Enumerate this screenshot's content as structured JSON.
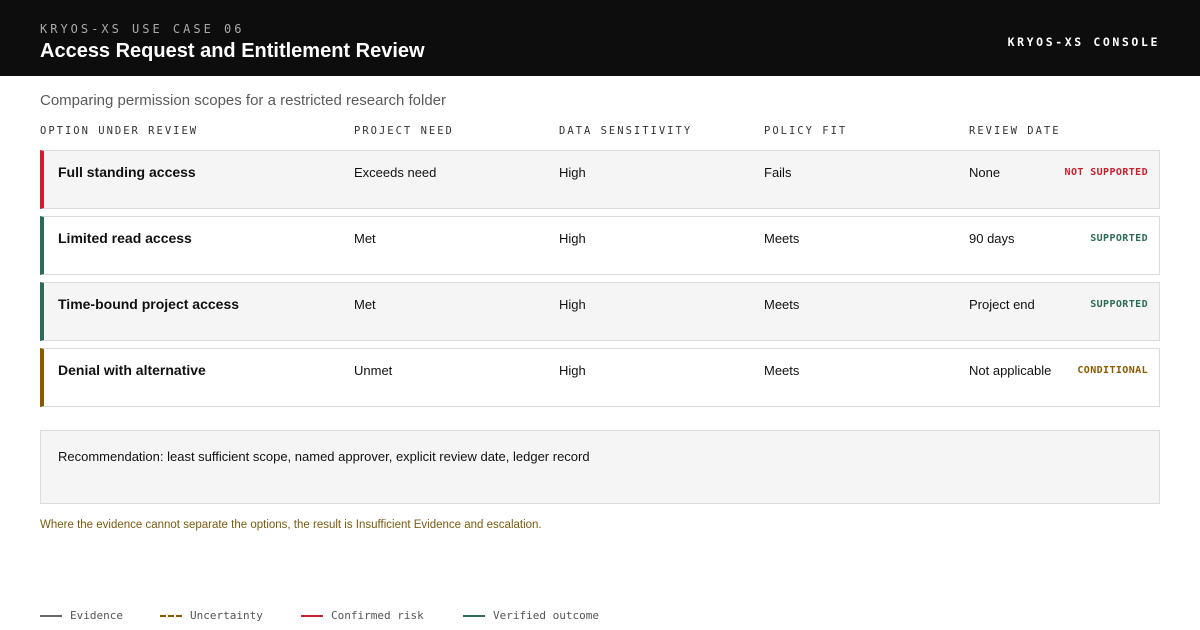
{
  "header": {
    "eyebrow": "KRYOS-XS USE CASE 06",
    "title": "Access Request and Entitlement Review",
    "console_label": "KRYOS-XS CONSOLE"
  },
  "subtitle": "Comparing permission scopes for a restricted research folder",
  "columns": [
    "OPTION UNDER REVIEW",
    "PROJECT NEED",
    "DATA SENSITIVITY",
    "POLICY FIT",
    "REVIEW DATE"
  ],
  "rows": [
    {
      "name": "Full standing access",
      "need": "Exceeds need",
      "sensitivity": "High",
      "policy": "Fails",
      "review": "None",
      "status": "NOT SUPPORTED"
    },
    {
      "name": "Limited read access",
      "need": "Met",
      "sensitivity": "High",
      "policy": "Meets",
      "review": "90 days",
      "status": "SUPPORTED"
    },
    {
      "name": "Time-bound project access",
      "need": "Met",
      "sensitivity": "High",
      "policy": "Meets",
      "review": "Project end",
      "status": "SUPPORTED"
    },
    {
      "name": "Denial with alternative",
      "need": "Unmet",
      "sensitivity": "High",
      "policy": "Meets",
      "review": "Not applicable",
      "status": "CONDITIONAL"
    }
  ],
  "status_colors": {
    "not_supported": "#c8202f",
    "supported": "#2e6b55",
    "conditional": "#8a5a00"
  },
  "recommendation": "Recommendation: least sufficient scope, named approver, explicit review date, ledger record",
  "note": "Where the evidence cannot separate the options, the result is Insufficient Evidence and escalation.",
  "legend": [
    {
      "label": "Evidence",
      "color": "#666666",
      "style": "solid"
    },
    {
      "label": "Uncertainty",
      "color": "#8a5a00",
      "style": "dashed"
    },
    {
      "label": "Confirmed risk",
      "color": "#c8202f",
      "style": "solid"
    },
    {
      "label": "Verified outcome",
      "color": "#2e6b55",
      "style": "solid"
    }
  ]
}
